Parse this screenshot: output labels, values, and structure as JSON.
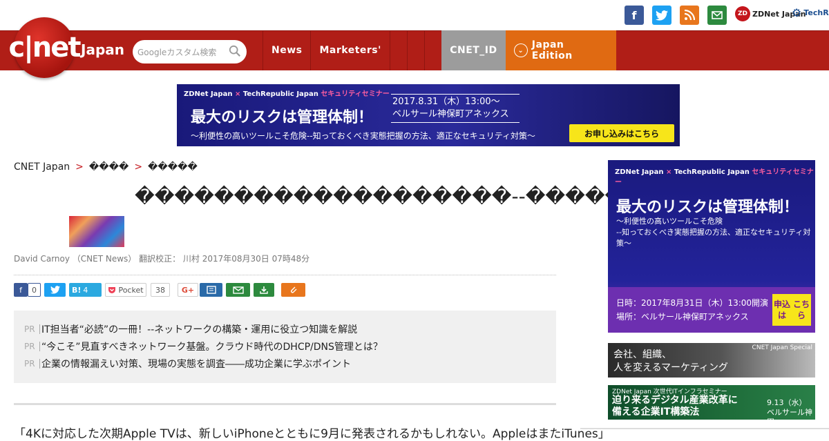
{
  "colors": {
    "brand_red": "#b01e17",
    "nav_gray": "#9c9c9c",
    "nav_orange": "#e06a12"
  },
  "social": {
    "facebook": "f",
    "twitter": "t",
    "rss": "rss",
    "mail": "mail",
    "zdnet": "ZDNet Japan",
    "techrepublic": "TechRep"
  },
  "logo": {
    "mark": "c|net",
    "edition": "Japan"
  },
  "search": {
    "placeholder": "Googleカスタム検索"
  },
  "nav": {
    "news": "News",
    "marketers": "Marketers'",
    "cnet_id": "CNET_ID",
    "edition": "Japan Edition"
  },
  "top_banner": {
    "brand_left": "ZDNet Japan",
    "brand_x": "×",
    "brand_right": "TechRepublic Japan",
    "seminar": "セキュリティセミナー",
    "headline": "最大のリスクは管理体制！",
    "subline": "〜利便性の高いツールこそ危険--知っておくべき実態把握の方法、適正なセキュリティ対策〜",
    "date": "2017.8.31（木）13:00〜",
    "venue": "ベルサール神保町アネックス",
    "cta": "お申し込みはこちら"
  },
  "breadcrumb": {
    "home": "CNET Japan",
    "sep1": ">",
    "level1": "����",
    "sep2": ">",
    "level2": "�����"
  },
  "article": {
    "title": "�������������������--�������",
    "byline": "David Carnoy （CNET News） 翻訳校正： 川村 2017年08月30日 07時48分",
    "body": "「4Kに対応した次期Apple TVは、新しいiPhoneとともに9月に発表されるかもしれない。AppleはまたiTunes」"
  },
  "share": {
    "facebook_count": "0",
    "hatena_label": "B!",
    "hatena_count": "4",
    "pocket_label": "Pocket",
    "pocket_count": "38",
    "gplus": "G+"
  },
  "pr": {
    "tag": "PR",
    "items": [
      "IT担当者“必読”の一冊！--ネットワークの構築・運用に役立つ知識を解説",
      "“今こそ”見直すべきネットワーク基盤。クラウド時代のDHCP/DNS管理とは？",
      "企業の情報漏えい対策、現場の実態を調査――成功企業に学ぶポイント"
    ]
  },
  "sidebar": {
    "ad": {
      "brand_left": "ZDNet Japan",
      "brand_x": "×",
      "brand_right": "TechRepublic Japan",
      "seminar": "セキュリティセミナー",
      "headline": "最大のリスクは管理体制！",
      "sub1": "〜利便性の高いツールこそ危険",
      "sub2": "--知っておくべき実態把握の方法、適正なセキュリティ対策〜",
      "date": "日時：2017年8月31日（木）13:00開演",
      "venue": "場所：ベルサール神保町アネックス",
      "cta1": "申込は",
      "cta2": "こちら"
    },
    "banner1": {
      "tag": "CNET Japan Special",
      "line1": "会社、組織、",
      "line2": "人を変えるマーケティング"
    },
    "banner2": {
      "tag": "ZDNet Japan 次世代ITインフラセミナー",
      "line1": "迫り来るデジタル産業改革に",
      "line2": "備える企業IT構築法",
      "date1": "9.13（水）",
      "date2": "ベルサール神田"
    }
  }
}
